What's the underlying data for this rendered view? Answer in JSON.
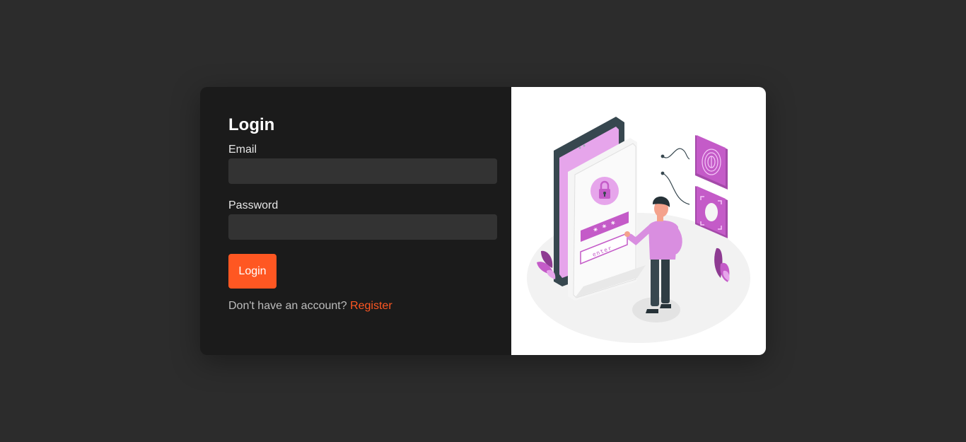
{
  "login": {
    "title": "Login",
    "email_label": "Email",
    "email_value": "",
    "password_label": "Password",
    "password_value": "",
    "submit_label": "Login",
    "footer_text": "Don't have an account?",
    "register_link": "Register"
  },
  "illustration": {
    "enter_text": "enter",
    "password_mask": "* * *"
  },
  "colors": {
    "accent": "#ff5722",
    "page_bg": "#2c2c2c",
    "panel_bg": "#1b1b1b",
    "input_bg": "#333333",
    "illustration_purple": "#c45bc8"
  }
}
